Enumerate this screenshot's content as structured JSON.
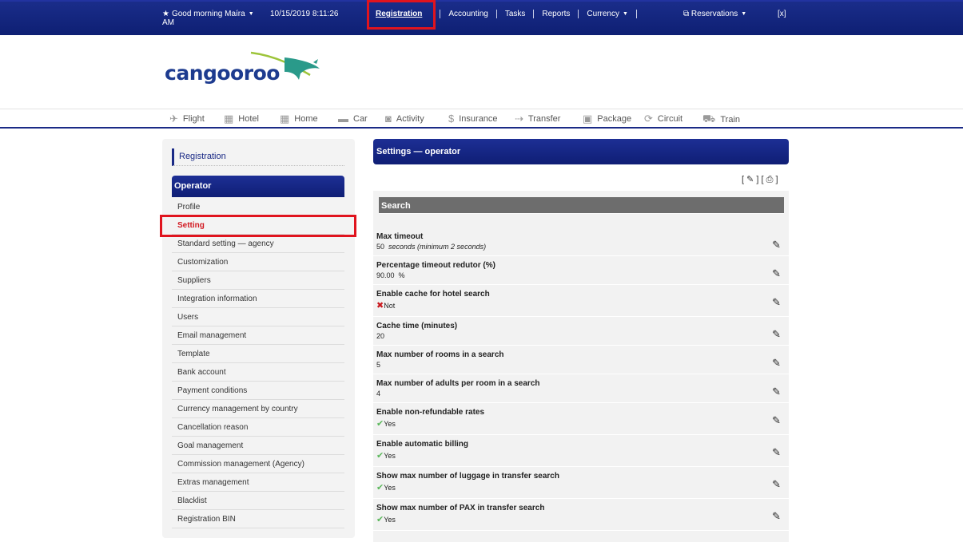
{
  "topbar": {
    "greeting": "Good morning Maíra",
    "datetime": "10/15/2019 8:11:26",
    "ampm": "AM",
    "nav": [
      "Registration",
      "Accounting",
      "Tasks",
      "Reports",
      "Currency"
    ],
    "reservations": "Reservations",
    "close": "[x]"
  },
  "brand": {
    "logo_text": "cangooroo",
    "logo_color": "#1d3b8f"
  },
  "products": [
    {
      "label": "Flight",
      "icon": "plane-icon"
    },
    {
      "label": "Hotel",
      "icon": "building-icon"
    },
    {
      "label": "Home",
      "icon": "building-icon"
    },
    {
      "label": "Car",
      "icon": "car-icon"
    },
    {
      "label": "Activity",
      "icon": "camera-icon"
    },
    {
      "label": "Insurance",
      "icon": "dollar-icon"
    },
    {
      "label": "Transfer",
      "icon": "transfer-icon"
    },
    {
      "label": "Package",
      "icon": "suitcase-icon"
    },
    {
      "label": "Circuit",
      "icon": "circuit-icon"
    },
    {
      "label": "Train",
      "icon": "train-icon"
    }
  ],
  "sidebar": {
    "breadcrumb": "Registration",
    "section_title": "Operator",
    "items": [
      "Profile",
      "Setting",
      "Standard setting — agency",
      "Customization",
      "Suppliers",
      "Integration information",
      "Users",
      "Email management",
      "Template",
      "Bank account",
      "Payment conditions",
      "Currency management by country",
      "Cancellation reason",
      "Goal management",
      "Commission management (Agency)",
      "Extras management",
      "Blacklist",
      "Registration BIN"
    ],
    "active_item": "Setting"
  },
  "main": {
    "title": "Settings — operator",
    "tools": [
      "[",
      "]",
      "[",
      "]"
    ],
    "section": "Search",
    "fields": [
      {
        "label": "Max timeout",
        "value": "50",
        "suffix": "seconds (minimum 2 seconds)"
      },
      {
        "label": "Percentage timeout redutor (%)",
        "value": "90.00",
        "suffix": "%"
      },
      {
        "label": "Enable cache for hotel search",
        "value": "Not",
        "status": "no"
      },
      {
        "label": "Cache time (minutes)",
        "value": "20"
      },
      {
        "label": "Max number of rooms in a search",
        "value": "5"
      },
      {
        "label": "Max number of adults per room in a search",
        "value": "4"
      },
      {
        "label": "Enable non-refundable rates",
        "value": "Yes",
        "status": "yes"
      },
      {
        "label": "Enable automatic billing",
        "value": "Yes",
        "status": "yes"
      },
      {
        "label": "Show max number of luggage in transfer search",
        "value": "Yes",
        "status": "yes"
      },
      {
        "label": "Show max number of PAX in transfer search",
        "value": "Yes",
        "status": "yes"
      }
    ]
  },
  "colors": {
    "navy": "#1a2a86",
    "highlight_red": "#e0141e",
    "section_gray": "#6d6d6d"
  }
}
